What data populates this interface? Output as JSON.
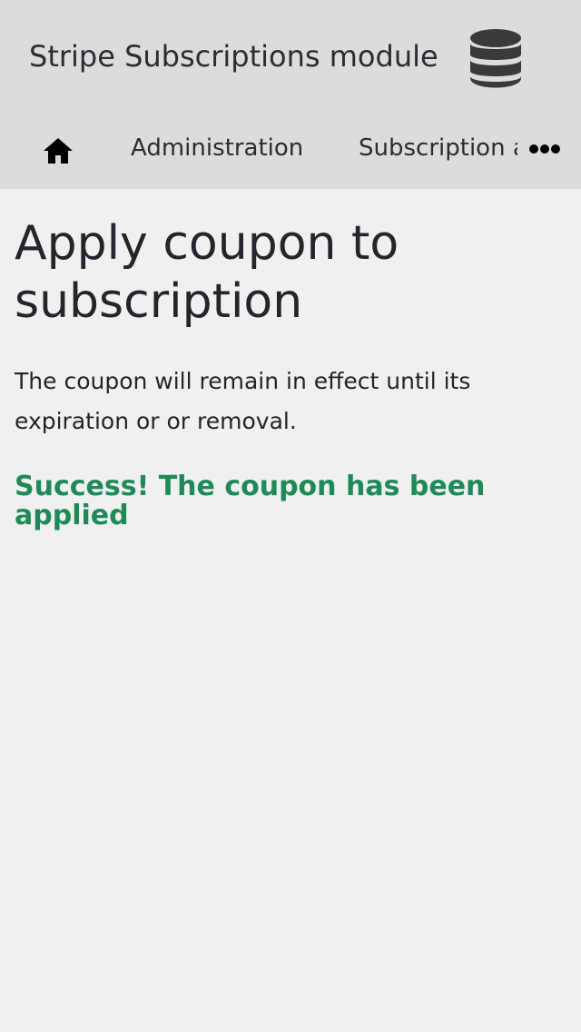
{
  "header": {
    "app_title": "Stripe Subscriptions module",
    "icon": "database-icon"
  },
  "nav": {
    "home_icon": "home-icon",
    "items": [
      {
        "label": "Administration"
      },
      {
        "label": "Subscription a"
      }
    ],
    "more_icon": "more-horizontal-icon"
  },
  "main": {
    "title": "Apply coupon to subscription",
    "description": "The coupon will remain in effect until its expiration or or removal.",
    "success_message": "Success! The coupon has been applied"
  },
  "colors": {
    "header_bg": "#dcdcdc",
    "page_bg": "#f0f0f0",
    "text": "#23252b",
    "success": "#1e8a57",
    "icon": "#3a3a3a"
  }
}
